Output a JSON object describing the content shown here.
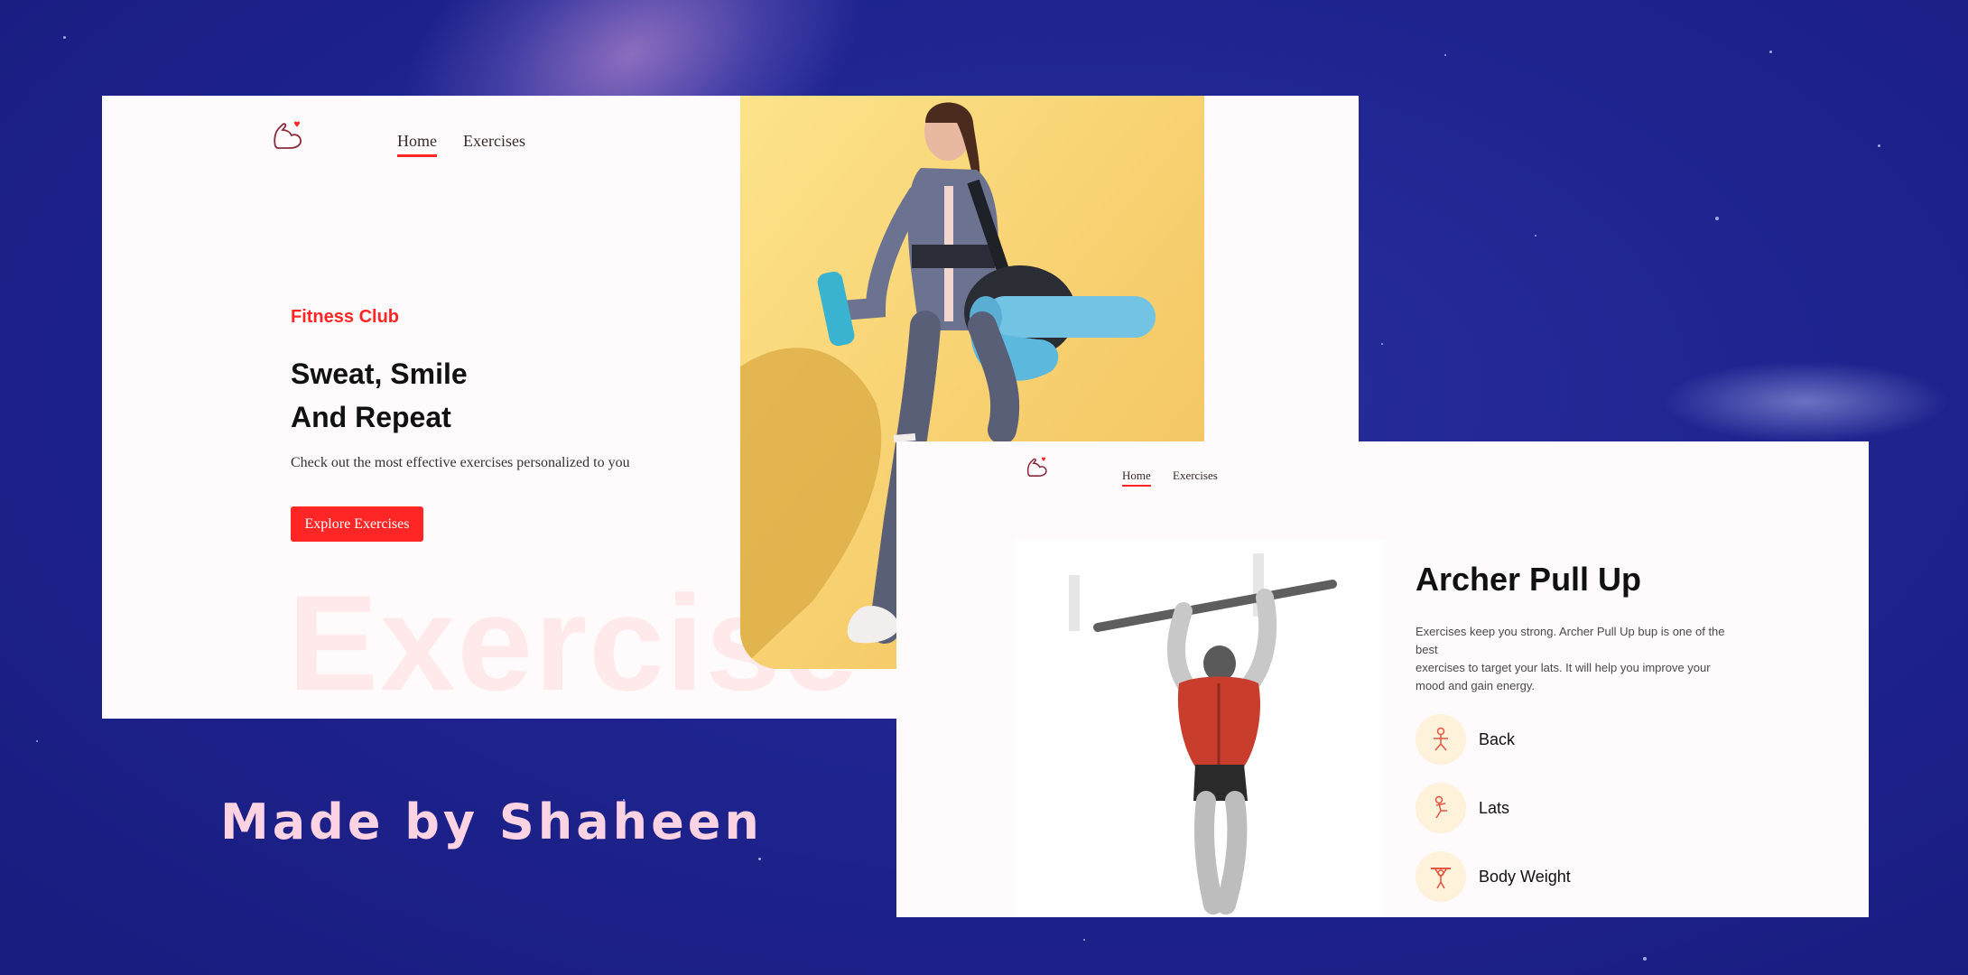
{
  "app": {
    "nav_home": "Home",
    "nav_exercises": "Exercises"
  },
  "home": {
    "kicker": "Fitness Club",
    "headline_line1": "Sweat, Smile",
    "headline_line2": "And Repeat",
    "subtitle": "Check out the most effective exercises personalized to you",
    "cta_label": "Explore Exercises",
    "ghost_text": "Exercise"
  },
  "exercise_detail": {
    "title": "Archer Pull Up",
    "desc_line1": "Exercises keep you strong. Archer Pull Up bup is one of the",
    "desc_line2": "best",
    "desc_line3": "exercises to target your lats. It will help you improve your",
    "desc_line4": "mood and gain energy.",
    "details": [
      {
        "icon": "body-part-icon",
        "label": "Back"
      },
      {
        "icon": "target-icon",
        "label": "Lats"
      },
      {
        "icon": "equipment-icon",
        "label": "Body Weight"
      }
    ]
  },
  "footer": {
    "credit": "Made by Shaheen"
  },
  "colors": {
    "accent": "#ff2625",
    "page_bg": "#fffbfc",
    "backdrop": "#1f2490",
    "hero_bg": "#fcd97a",
    "badge_bg": "#fff2db",
    "credit": "#fcd3e2"
  }
}
